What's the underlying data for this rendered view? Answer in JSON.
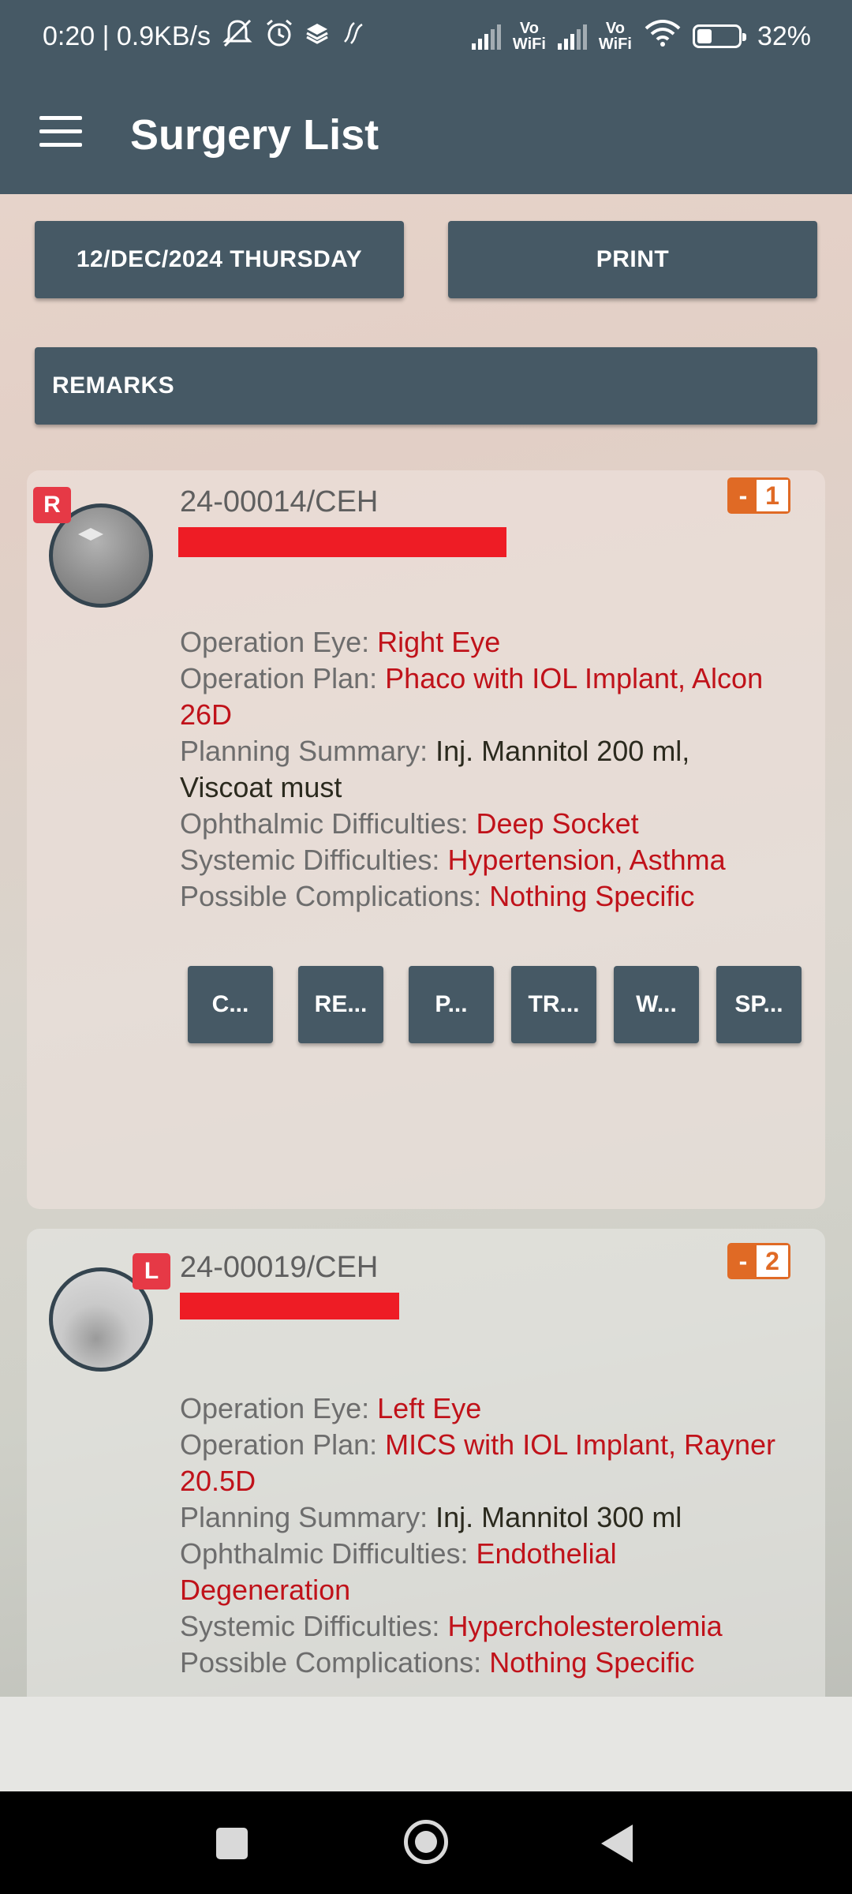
{
  "status_bar": {
    "time_speed": "0:20 | 0.9KB/s",
    "vowifi_1": "Vo WiFi",
    "vowifi_2": "Vo WiFi",
    "battery_text": "32%",
    "icons": [
      "mute-icon",
      "alarm-icon",
      "layers-icon",
      "nfc-icon",
      "signal-icon",
      "wifi-icon",
      "battery-icon"
    ]
  },
  "app_bar": {
    "title": "Surgery List"
  },
  "controls": {
    "date_label": "12/DEC/2024 THURSDAY",
    "print_label": "PRINT",
    "remarks_label": "REMARKS"
  },
  "cards": [
    {
      "eye_badge": "R",
      "reg_no": "24-00014/CEH",
      "seq_minus": "-",
      "seq_num": "1",
      "operation_eye_label": "Operation Eye:",
      "operation_eye": "Right Eye",
      "operation_plan_label": "Operation Plan:",
      "operation_plan_1": "Phaco with IOL Implant, Alcon",
      "operation_plan_2": "26D",
      "planning_summary_label": "Planning Summary:",
      "planning_summary_1": "Inj. Mannitol 200 ml,",
      "planning_summary_2": "Viscoat must",
      "ophthalmic_label": "Ophthalmic Difficulties:",
      "ophthalmic": "Deep Socket",
      "systemic_label": "Systemic Difficulties:",
      "systemic": "Hypertension, Asthma",
      "complications_label": "Possible Complications:",
      "complications": "Nothing Specific",
      "actions": [
        "C...",
        "RE...",
        "P...",
        "TR...",
        "W...",
        "SP..."
      ]
    },
    {
      "eye_badge": "L",
      "reg_no": "24-00019/CEH",
      "seq_minus": "-",
      "seq_num": "2",
      "operation_eye_label": "Operation Eye:",
      "operation_eye": "Left Eye",
      "operation_plan_label": "Operation Plan:",
      "operation_plan_1": "MICS with IOL Implant, Rayner",
      "operation_plan_2": "20.5D",
      "planning_summary_label": "Planning Summary:",
      "planning_summary_1": "Inj. Mannitol 300 ml",
      "ophthalmic_label": "Ophthalmic Difficulties:",
      "ophthalmic_1": "Endothelial",
      "ophthalmic_2": "Degeneration",
      "systemic_label": "Systemic Difficulties:",
      "systemic": "Hypercholesterolemia",
      "complications_label": "Possible Complications:",
      "complications": "Nothing Specific"
    }
  ],
  "colors": {
    "primary": "#465965",
    "value_red": "#c0121a",
    "badge_red": "#e63946",
    "seq_orange": "#e06a25",
    "redaction": "#ee1c25"
  }
}
